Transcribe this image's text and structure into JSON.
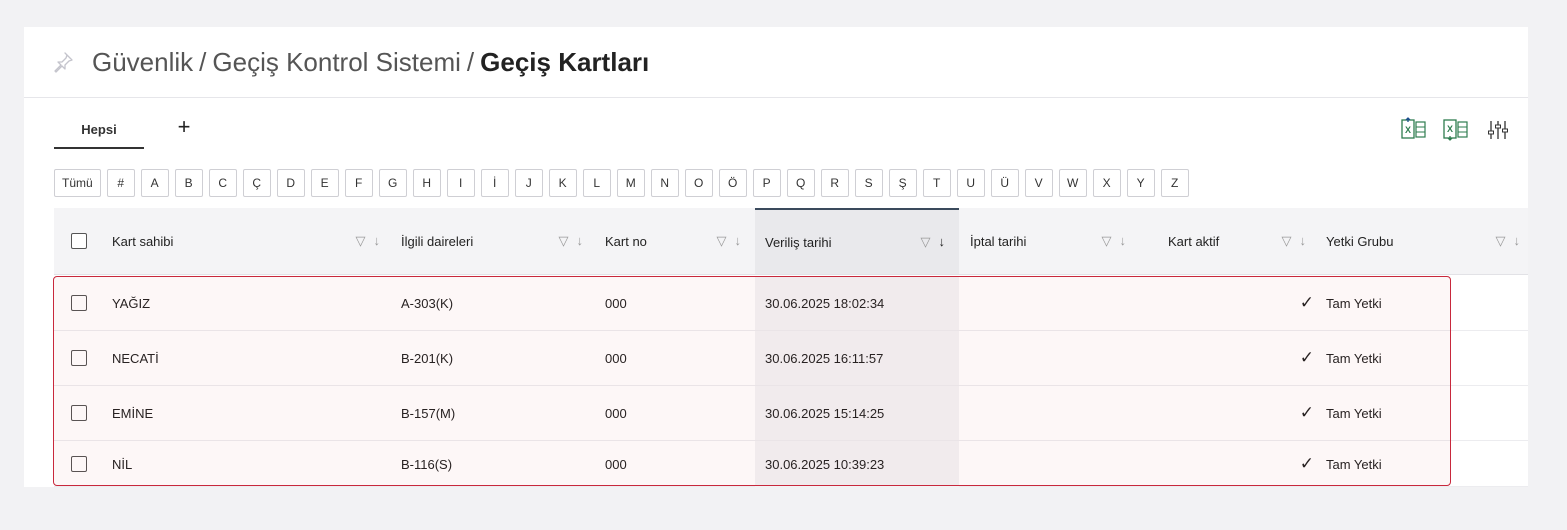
{
  "breadcrumb": {
    "part1": "Güvenlik",
    "separator": "/",
    "part2": "Geçiş Kontrol Sistemi",
    "current": "Geçiş Kartları"
  },
  "tabs": [
    {
      "label": "Hepsi"
    }
  ],
  "add_tab_label": "+",
  "toolbar_icons": [
    "excel-import-icon",
    "excel-export-icon",
    "column-settings-icon"
  ],
  "letters": [
    "Tümü",
    "#",
    "A",
    "B",
    "C",
    "Ç",
    "D",
    "E",
    "F",
    "G",
    "H",
    "I",
    "İ",
    "J",
    "K",
    "L",
    "M",
    "N",
    "O",
    "Ö",
    "P",
    "Q",
    "R",
    "S",
    "Ş",
    "T",
    "U",
    "Ü",
    "V",
    "W",
    "X",
    "Y",
    "Z"
  ],
  "columns": [
    {
      "label": "Kart sahibi"
    },
    {
      "label": "İlgili daireleri"
    },
    {
      "label": "Kart no"
    },
    {
      "label": "Veriliş tarihi"
    },
    {
      "label": "İptal tarihi"
    },
    {
      "label": "Kart aktif"
    },
    {
      "label": "Yetki Grubu"
    }
  ],
  "sorted_column": "Veriliş tarihi",
  "rows": [
    {
      "owner": "YAĞIZ",
      "unit": "A-303(K)",
      "card_no": "000",
      "issue_date": "30.06.2025 18:02:34",
      "cancel_date": "",
      "active": "✓",
      "group": "Tam Yetki"
    },
    {
      "owner": "NECATİ",
      "unit": "B-201(K)",
      "card_no": "000",
      "issue_date": "30.06.2025 16:11:57",
      "cancel_date": "",
      "active": "✓",
      "group": "Tam Yetki"
    },
    {
      "owner": "EMİNE",
      "unit": "B-157(M)",
      "card_no": "000",
      "issue_date": "30.06.2025 15:14:25",
      "cancel_date": "",
      "active": "✓",
      "group": "Tam Yetki"
    },
    {
      "owner": "NİL",
      "unit": "B-116(S)",
      "card_no": "000",
      "issue_date": "30.06.2025 10:39:23",
      "cancel_date": "",
      "active": "✓",
      "group": "Tam Yetki"
    }
  ],
  "colors": {
    "highlight": "#c8283c",
    "sorted_border": "#3a4a5c",
    "excel_green": "#2e7d4f"
  }
}
